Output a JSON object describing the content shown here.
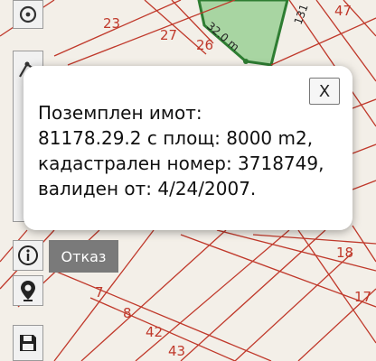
{
  "map": {
    "parcel_numbers": [
      {
        "id": "p23",
        "text": "23"
      },
      {
        "id": "p27",
        "text": "27"
      },
      {
        "id": "p26",
        "text": "26"
      },
      {
        "id": "p47",
        "text": "47"
      },
      {
        "id": "p18",
        "text": "18"
      },
      {
        "id": "p17",
        "text": "17"
      },
      {
        "id": "p7",
        "text": "7"
      },
      {
        "id": "p8",
        "text": "8"
      },
      {
        "id": "p42",
        "text": "42"
      },
      {
        "id": "p43",
        "text": "43"
      }
    ],
    "edge_labels": {
      "edge_1": "32.0 m",
      "edge_2": "131"
    },
    "colors": {
      "parcel_line": "#c0392b",
      "selected_outline": "#2e7d32",
      "selected_fill": "#a8d5a2"
    }
  },
  "toolbar": {
    "locate_icon": "crosshair-icon",
    "measure_icon": "measure-icon",
    "info_icon": "info-icon",
    "pin_icon": "map-pin-icon",
    "save_icon": "floppy-disk-icon",
    "cancel_label": "Отказ"
  },
  "popup": {
    "close_label": "X",
    "line1": "Поземплен имот:",
    "line2": "81178.29.2 с площ: 8000 m2,",
    "line3": "кадастрален номер: 3718749,",
    "line4": "валиден от: 4/24/2007."
  }
}
